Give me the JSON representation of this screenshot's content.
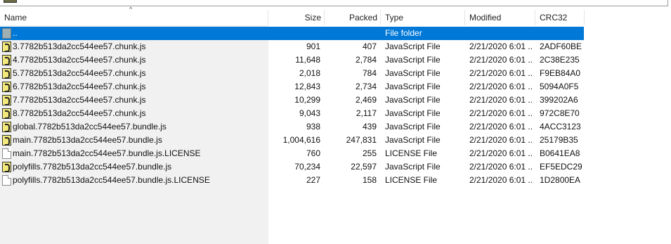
{
  "columns": {
    "name": "Name",
    "size": "Size",
    "packed": "Packed",
    "type": "Type",
    "modified": "Modified",
    "crc": "CRC32"
  },
  "rows": [
    {
      "icon": "folder-up-icon",
      "name": "..",
      "size": "",
      "packed": "",
      "type": "File folder",
      "modified": "",
      "crc": "",
      "selected": true
    },
    {
      "icon": "js-file-icon",
      "name": "3.7782b513da2cc544ee57.chunk.js",
      "size": "901",
      "packed": "407",
      "type": "JavaScript File",
      "modified": "2/21/2020 6:01 ...",
      "crc": "2ADF60BE"
    },
    {
      "icon": "js-file-icon",
      "name": "4.7782b513da2cc544ee57.chunk.js",
      "size": "11,648",
      "packed": "2,784",
      "type": "JavaScript File",
      "modified": "2/21/2020 6:01 ...",
      "crc": "2C38E235"
    },
    {
      "icon": "js-file-icon",
      "name": "5.7782b513da2cc544ee57.chunk.js",
      "size": "2,018",
      "packed": "784",
      "type": "JavaScript File",
      "modified": "2/21/2020 6:01 ...",
      "crc": "F9EB84A0"
    },
    {
      "icon": "js-file-icon",
      "name": "6.7782b513da2cc544ee57.chunk.js",
      "size": "12,843",
      "packed": "2,734",
      "type": "JavaScript File",
      "modified": "2/21/2020 6:01 ...",
      "crc": "5094A0F5"
    },
    {
      "icon": "js-file-icon",
      "name": "7.7782b513da2cc544ee57.chunk.js",
      "size": "10,299",
      "packed": "2,469",
      "type": "JavaScript File",
      "modified": "2/21/2020 6:01 ...",
      "crc": "399202A6"
    },
    {
      "icon": "js-file-icon",
      "name": "8.7782b513da2cc544ee57.chunk.js",
      "size": "9,043",
      "packed": "2,117",
      "type": "JavaScript File",
      "modified": "2/21/2020 6:01 ...",
      "crc": "972C8E70"
    },
    {
      "icon": "js-file-icon",
      "name": "global.7782b513da2cc544ee57.bundle.js",
      "size": "938",
      "packed": "439",
      "type": "JavaScript File",
      "modified": "2/21/2020 6:01 ...",
      "crc": "4ACC3123"
    },
    {
      "icon": "js-file-icon",
      "name": "main.7782b513da2cc544ee57.bundle.js",
      "size": "1,004,616",
      "packed": "247,831",
      "type": "JavaScript File",
      "modified": "2/21/2020 6:01 ...",
      "crc": "25179B35"
    },
    {
      "icon": "document-icon",
      "name": "main.7782b513da2cc544ee57.bundle.js.LICENSE",
      "size": "760",
      "packed": "255",
      "type": "LICENSE File",
      "modified": "2/21/2020 6:01 ...",
      "crc": "B0641EA8"
    },
    {
      "icon": "js-file-icon",
      "name": "polyfills.7782b513da2cc544ee57.bundle.js",
      "size": "70,234",
      "packed": "22,597",
      "type": "JavaScript File",
      "modified": "2/21/2020 6:01 ...",
      "crc": "EF5EDC29"
    },
    {
      "icon": "document-icon",
      "name": "polyfills.7782b513da2cc544ee57.bundle.js.LICENSE",
      "size": "227",
      "packed": "158",
      "type": "LICENSE File",
      "modified": "2/21/2020 6:01 ...",
      "crc": "1D2800EA"
    }
  ],
  "colors": {
    "selection": "#0078d7",
    "left_pane": "#f1f1f1"
  }
}
